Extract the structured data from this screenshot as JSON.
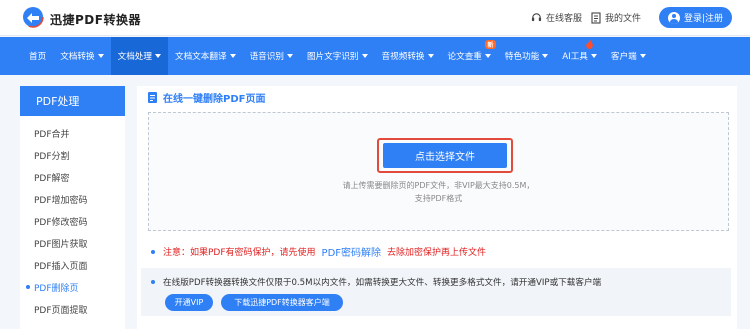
{
  "header": {
    "brand": "迅捷PDF转换器",
    "service_link": "在线客服",
    "files_link": "我的文件",
    "login_label": "登录|注册"
  },
  "nav": {
    "items": [
      {
        "label": "首页",
        "caret": false
      },
      {
        "label": "文档转换",
        "caret": true
      },
      {
        "label": "文档处理",
        "caret": true,
        "active": true
      },
      {
        "label": "文档文本翻译",
        "caret": true
      },
      {
        "label": "语音识别",
        "caret": true
      },
      {
        "label": "图片文字识别",
        "caret": true
      },
      {
        "label": "音视频转换",
        "caret": true
      },
      {
        "label": "论文查重",
        "caret": true,
        "badge": "新"
      },
      {
        "label": "特色功能",
        "caret": true
      },
      {
        "label": "AI工具",
        "caret": true,
        "fire": true
      },
      {
        "label": "客户端",
        "caret": true
      }
    ]
  },
  "sidebar": {
    "title": "PDF处理",
    "items": [
      {
        "label": "PDF合并"
      },
      {
        "label": "PDF分割"
      },
      {
        "label": "PDF解密"
      },
      {
        "label": "PDF增加密码"
      },
      {
        "label": "PDF修改密码"
      },
      {
        "label": "PDF图片获取"
      },
      {
        "label": "PDF插入页面"
      },
      {
        "label": "PDF删除页",
        "active": true
      },
      {
        "label": "PDF页面提取"
      }
    ]
  },
  "main": {
    "section_title": "在线一键删除PDF页面",
    "upload_button": "点击选择文件",
    "hint_line1": "请上传需要删除页的PDF文件，非VIP最大支持0.5M，",
    "hint_line2": "支持PDF格式",
    "notice_prefix": "注意：如果PDF有密码保护，请先使用",
    "notice_link": "PDF密码解除",
    "notice_suffix": "去除加密保护再上传文件",
    "info_text": "在线版PDF转换器转换文件仅限于0.5M以内文件，如需转换更大文件、转换更多格式文件，请开通VIP或下载客户端",
    "vip_button": "开通VIP",
    "download_button": "下载迅捷PDF转换器客户端"
  },
  "colors": {
    "primary": "#2f7ff5",
    "nav_active": "#1968d8",
    "warning": "#e02020",
    "highlight_outline": "#e24a3b"
  }
}
